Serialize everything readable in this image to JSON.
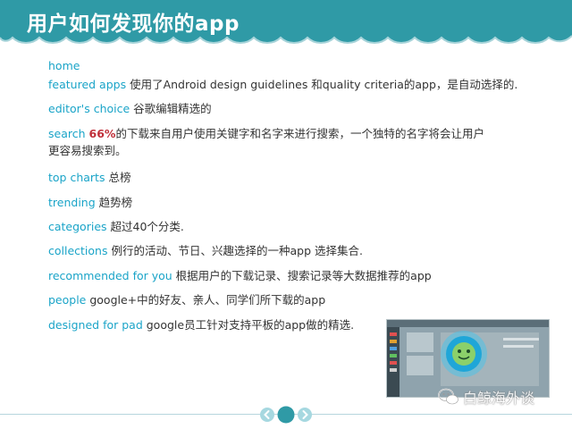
{
  "header": {
    "title": "用户如何发现你的app"
  },
  "colors": {
    "header": "#2f9aa6",
    "keyword": "#1aa4c8",
    "highlight": "#c0303a",
    "body_text": "#333333"
  },
  "items": [
    {
      "key": "home",
      "text": ""
    },
    {
      "key": "featured apps",
      "text": " 使用了Android design guidelines 和quality criteria的app，是自动选择的."
    },
    {
      "key": "editor's choice",
      "text": " 谷歌编辑精选的"
    },
    {
      "key": "search",
      "highlight": "66%",
      "text": "的下载来自用户使用关键字和名字来进行搜索，一个独特的名字将会让用户",
      "text2": "更容易搜索到。"
    },
    {
      "key": "top charts",
      "text": " 总榜"
    },
    {
      "key": "trending",
      "text": " 趋势榜"
    },
    {
      "key": "categories",
      "text": " 超过40个分类."
    },
    {
      "key": "collections",
      "text": " 例行的活动、节日、兴趣选择的一种app 选择集合."
    },
    {
      "key": "recommended for you",
      "text": " 根据用户的下载记录、搜索记录等大数据推荐的app"
    },
    {
      "key": "people",
      "text": " google+中的好友、亲人、同学们所下载的app"
    },
    {
      "key": "designed for pad",
      "text": " google员工针对支持平板的app做的精选."
    }
  ],
  "watermark": {
    "text": "白鲸海外谈",
    "icon": "wechat-icon"
  },
  "nav": {
    "prev_icon": "chevron-left-icon",
    "current_icon": "dot-icon",
    "next_icon": "chevron-right-icon"
  }
}
